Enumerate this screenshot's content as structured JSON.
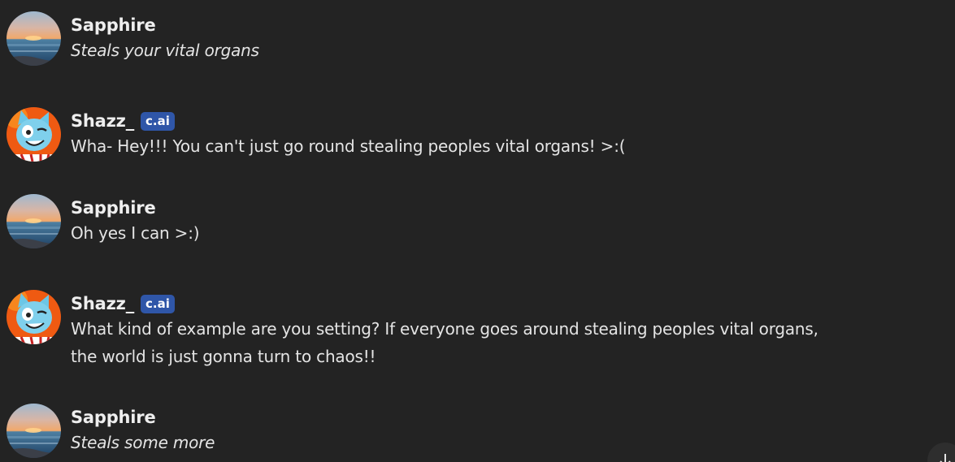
{
  "badge_label": "c.ai",
  "messages": [
    {
      "name": "Sapphire",
      "text": "Steals your vital organs",
      "italic": true,
      "has_badge": false,
      "avatar": "sunset-ocean-avatar"
    },
    {
      "name": "Shazz_",
      "text": "Wha- Hey!!! You can't just go round stealing peoples vital organs! >:(",
      "italic": false,
      "has_badge": true,
      "avatar": "blue-cat-avatar"
    },
    {
      "name": "Sapphire",
      "text": "Oh yes I can >:)",
      "italic": false,
      "has_badge": false,
      "avatar": "sunset-ocean-avatar"
    },
    {
      "name": "Shazz_",
      "text": "What kind of example are you setting? If everyone goes around stealing peoples vital organs, the world is just gonna turn to chaos!!",
      "italic": false,
      "has_badge": true,
      "avatar": "blue-cat-avatar"
    },
    {
      "name": "Sapphire",
      "text": "Steals some more",
      "italic": true,
      "has_badge": false,
      "avatar": "sunset-ocean-avatar"
    }
  ],
  "colors": {
    "background": "#232323",
    "badge": "#2f56a8",
    "text": "#e4e4e4"
  },
  "scroll_button_icon": "arrow-down-icon"
}
